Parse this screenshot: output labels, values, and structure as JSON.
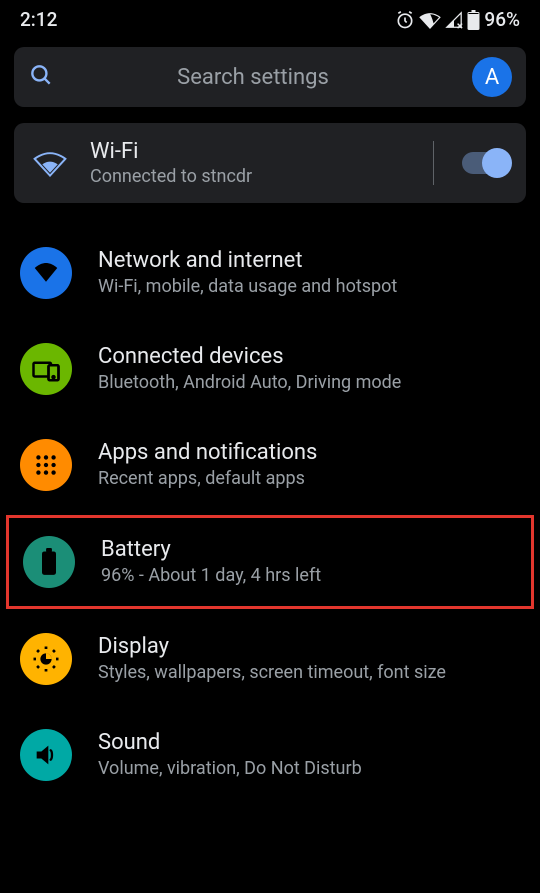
{
  "status_bar": {
    "time": "2:12",
    "battery_percent": "96%"
  },
  "search": {
    "placeholder": "Search settings",
    "avatar_letter": "A"
  },
  "wifi_card": {
    "title": "Wi-Fi",
    "subtitle": "Connected to stncdr",
    "toggle_on": true
  },
  "settings": [
    {
      "title": "Network and internet",
      "subtitle": "Wi-Fi, mobile, data usage and hotspot"
    },
    {
      "title": "Connected devices",
      "subtitle": "Bluetooth, Android Auto, Driving mode"
    },
    {
      "title": "Apps and notifications",
      "subtitle": "Recent apps, default apps"
    },
    {
      "title": "Battery",
      "subtitle": "96% - About 1 day, 4 hrs left",
      "highlighted": true
    },
    {
      "title": "Display",
      "subtitle": "Styles, wallpapers, screen timeout, font size"
    },
    {
      "title": "Sound",
      "subtitle": "Volume, vibration, Do Not Disturb"
    }
  ]
}
